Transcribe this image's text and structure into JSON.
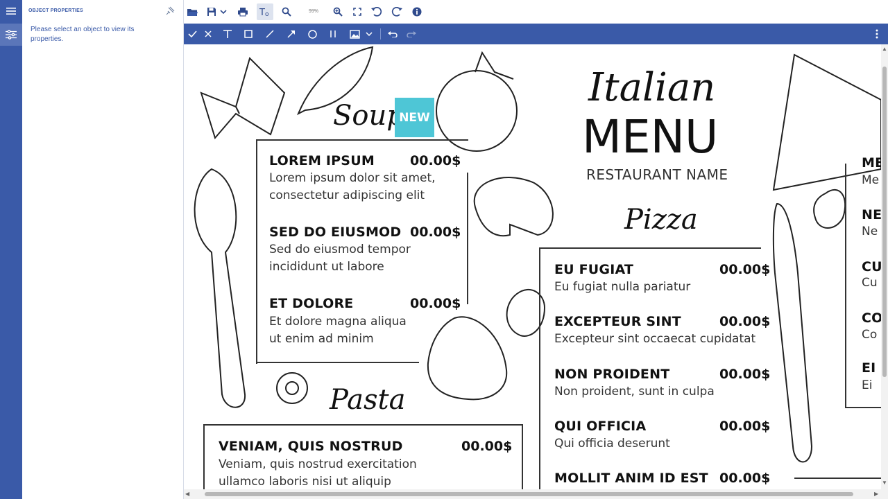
{
  "sidebar": {
    "title": "OBJECT PROPERTIES",
    "message": "Please select an object to view its properties."
  },
  "toolbar": {
    "zoom": "99%"
  },
  "menu": {
    "title_script": "Italian",
    "title_big": "MENU",
    "restaurant": "RESTAURANT NAME",
    "badge": "NEW",
    "soup": {
      "heading": "Soup",
      "items": [
        {
          "name": "LOREM IPSUM",
          "price": "00.00$",
          "line1": "Lorem ipsum dolor sit amet,",
          "line2": "consectetur adipiscing elit"
        },
        {
          "name": "SED DO EIUSMOD",
          "price": "00.00$",
          "line1": "Sed do eiusmod tempor",
          "line2": "incididunt ut labore"
        },
        {
          "name": "ET DOLORE",
          "price": "00.00$",
          "line1": "Et dolore magna aliqua",
          "line2": "ut enim ad minim"
        }
      ]
    },
    "pasta": {
      "heading": "Pasta",
      "items": [
        {
          "name": "VENIAM, QUIS NOSTRUD",
          "price": "00.00$",
          "line1": "Veniam, quis nostrud exercitation",
          "line2": "ullamco laboris nisi ut aliquip"
        }
      ]
    },
    "pizza": {
      "heading": "Pizza",
      "items": [
        {
          "name": "EU FUGIAT",
          "price": "00.00$",
          "line1": "Eu fugiat nulla pariatur"
        },
        {
          "name": "EXCEPTEUR SINT",
          "price": "00.00$",
          "line1": "Excepteur sint occaecat cupidatat"
        },
        {
          "name": "NON PROIDENT",
          "price": "00.00$",
          "line1": "Non proident, sunt in culpa"
        },
        {
          "name": "QUI OFFICIA",
          "price": "00.00$",
          "line1": "Qui officia deserunt"
        },
        {
          "name": "MOLLIT ANIM ID EST",
          "price": "00.00$"
        }
      ]
    },
    "right_column": [
      {
        "name": "ME",
        "line1": "Me"
      },
      {
        "name": "NE",
        "line1": "Ne"
      },
      {
        "name": "CU",
        "line1": "Cu"
      },
      {
        "name": "CO",
        "line1": "Co"
      },
      {
        "name": "EI",
        "line1": "Ei"
      }
    ]
  }
}
